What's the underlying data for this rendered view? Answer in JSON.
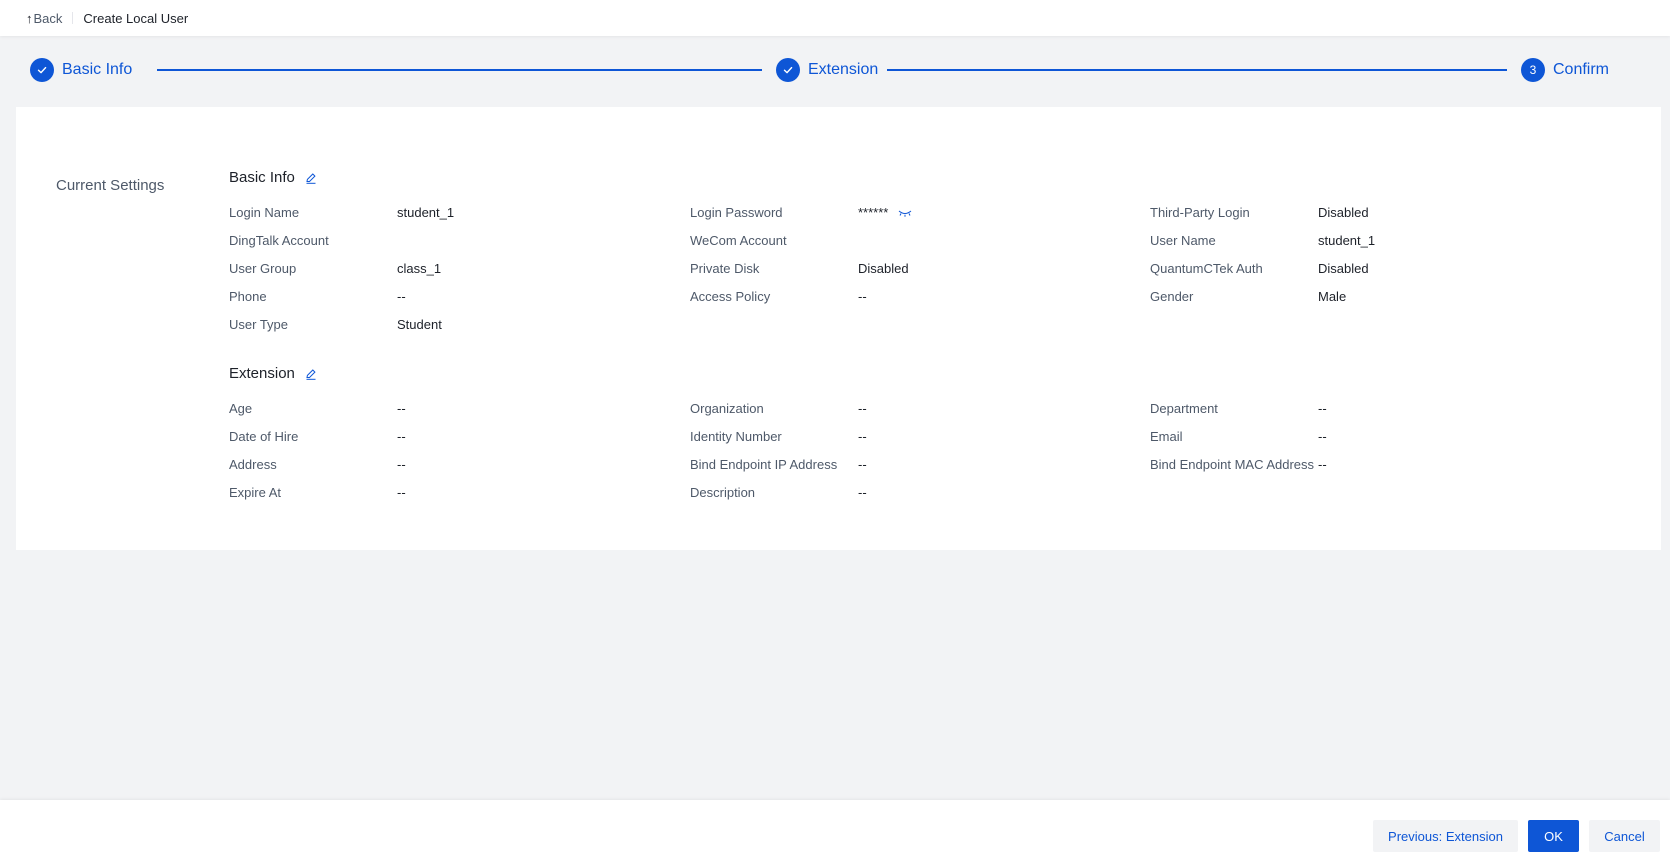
{
  "header": {
    "back_label": "Back",
    "title": "Create Local User"
  },
  "steps": [
    {
      "label": "Basic Info",
      "state": "done",
      "marker": ""
    },
    {
      "label": "Extension",
      "state": "done",
      "marker": ""
    },
    {
      "label": "Confirm",
      "state": "current",
      "marker": "3"
    }
  ],
  "colors": {
    "accent": "#0e56d6",
    "page_bg": "#f2f3f5",
    "label_text": "#4e5969"
  },
  "summary": {
    "section_title": "Current Settings",
    "basic_info": {
      "title": "Basic Info",
      "fields": [
        {
          "label": "Login Name",
          "value": "student_1"
        },
        {
          "label": "Login Password",
          "value": "******"
        },
        {
          "label": "Third-Party Login",
          "value": "Disabled"
        },
        {
          "label": "DingTalk Account",
          "value": ""
        },
        {
          "label": "WeCom Account",
          "value": ""
        },
        {
          "label": "User Name",
          "value": "student_1"
        },
        {
          "label": "User Group",
          "value": "class_1"
        },
        {
          "label": "Private Disk",
          "value": "Disabled"
        },
        {
          "label": "QuantumCTek Auth",
          "value": "Disabled"
        },
        {
          "label": "Phone",
          "value": "--"
        },
        {
          "label": "Access Policy",
          "value": "--"
        },
        {
          "label": "Gender",
          "value": "Male"
        },
        {
          "label": "User Type",
          "value": "Student"
        }
      ]
    },
    "extension": {
      "title": "Extension",
      "fields": [
        {
          "label": "Age",
          "value": "--"
        },
        {
          "label": "Organization",
          "value": "--"
        },
        {
          "label": "Department",
          "value": "--"
        },
        {
          "label": "Date of Hire",
          "value": "--"
        },
        {
          "label": "Identity Number",
          "value": "--"
        },
        {
          "label": "Email",
          "value": "--"
        },
        {
          "label": "Address",
          "value": "--"
        },
        {
          "label": "Bind Endpoint IP Address",
          "value": "--"
        },
        {
          "label": "Bind Endpoint MAC Address",
          "value": "--"
        },
        {
          "label": "Expire At",
          "value": "--"
        },
        {
          "label": "Description",
          "value": "--"
        }
      ]
    }
  },
  "footer": {
    "previous_label": "Previous: Extension",
    "ok_label": "OK",
    "cancel_label": "Cancel"
  }
}
